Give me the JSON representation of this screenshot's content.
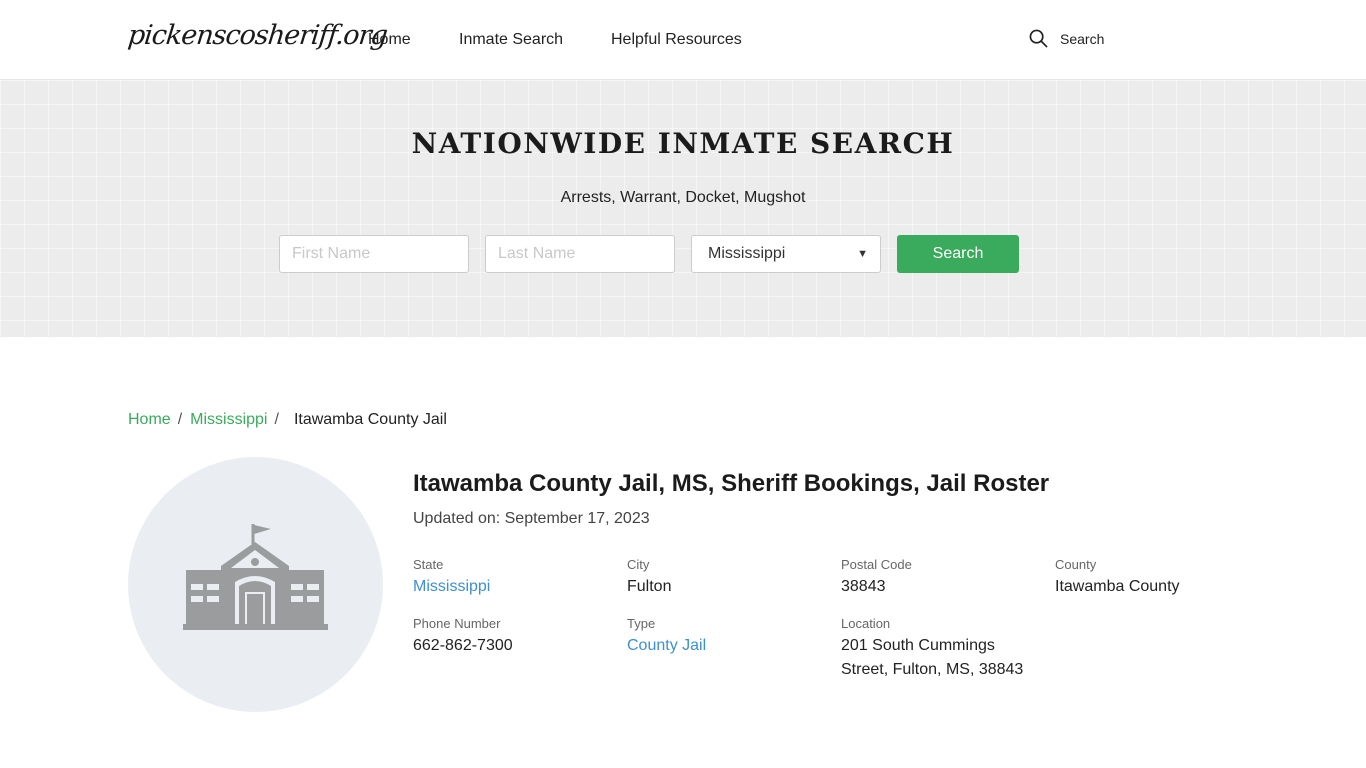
{
  "header": {
    "logo": "pickenscosheriff.org",
    "nav": [
      "Home",
      "Inmate Search",
      "Helpful Resources"
    ],
    "search_label": "Search"
  },
  "hero": {
    "title": "NATIONWIDE INMATE SEARCH",
    "subtitle": "Arrests, Warrant, Docket, Mugshot",
    "first_placeholder": "First Name",
    "last_placeholder": "Last Name",
    "state_selected": "Mississippi",
    "search_button": "Search"
  },
  "breadcrumb": {
    "home": "Home",
    "state": "Mississippi",
    "current": "Itawamba County Jail",
    "separator": "/"
  },
  "facility": {
    "icon": "building-icon",
    "title": "Itawamba County Jail, MS, Sheriff Bookings, Jail Roster",
    "updated_prefix": "Updated on: ",
    "updated_date": "September 17, 2023",
    "fields": {
      "state_label": "State",
      "state_value": "Mississippi",
      "city_label": "City",
      "city_value": "Fulton",
      "postal_label": "Postal Code",
      "postal_value": "38843",
      "county_label": "County",
      "county_value": "Itawamba County",
      "phone_label": "Phone Number",
      "phone_value": "662-862-7300",
      "type_label": "Type",
      "type_value": "County Jail",
      "location_label": "Location",
      "location_line1": "201 South Cummings",
      "location_line2": "Street, Fulton, MS, 38843"
    }
  },
  "colors": {
    "accent_green": "#3aaa5c",
    "link_blue": "#3d8fcf",
    "hero_bg": "#ececec"
  }
}
